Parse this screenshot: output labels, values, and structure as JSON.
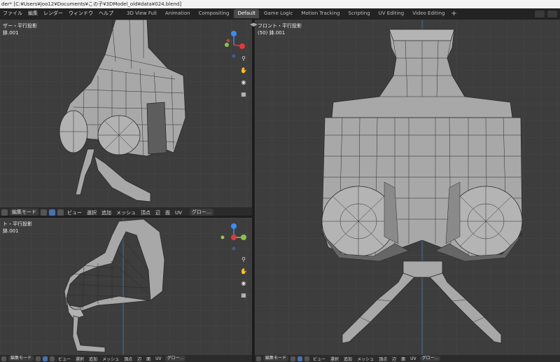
{
  "window": {
    "title": "der* [C:¥Users¥joo12¥Documents¥この子¥3DModel_old¥data¥024.blend]"
  },
  "menu": {
    "items": [
      "ファイル",
      "編集",
      "レンダー",
      "ウィンドウ",
      "ヘルプ"
    ]
  },
  "workspaces": {
    "tabs": [
      "3D View Full",
      "Animation",
      "Compositing",
      "Default",
      "Game Logic",
      "Motion Tracking",
      "Scripting",
      "UV Editing",
      "Video Editing"
    ],
    "active": "Default",
    "add_label": "+"
  },
  "viewports": {
    "top_left": {
      "view_label": "ザー・平行投影",
      "object_label": "鉢.001"
    },
    "bottom_left": {
      "view_label": "ト・平行投影",
      "object_label": "鉢.001"
    },
    "right": {
      "view_label": "フロント・平行投影",
      "object_label": "(50) 鉢.001"
    }
  },
  "viewport_header": {
    "mode": "編集モード",
    "menus": [
      "ビュー",
      "選択",
      "追加",
      "メッシュ",
      "頂点",
      "辺",
      "面",
      "UV"
    ],
    "transform": "グロー..."
  },
  "colors": {
    "axis_x": "#e0393e",
    "axis_y": "#8bc34a",
    "axis_z": "#3d8bf2",
    "mesh_fill": "#a8a8a8",
    "mesh_wire": "#2a2a2a",
    "viewport_bg": "#3d3d3d"
  }
}
